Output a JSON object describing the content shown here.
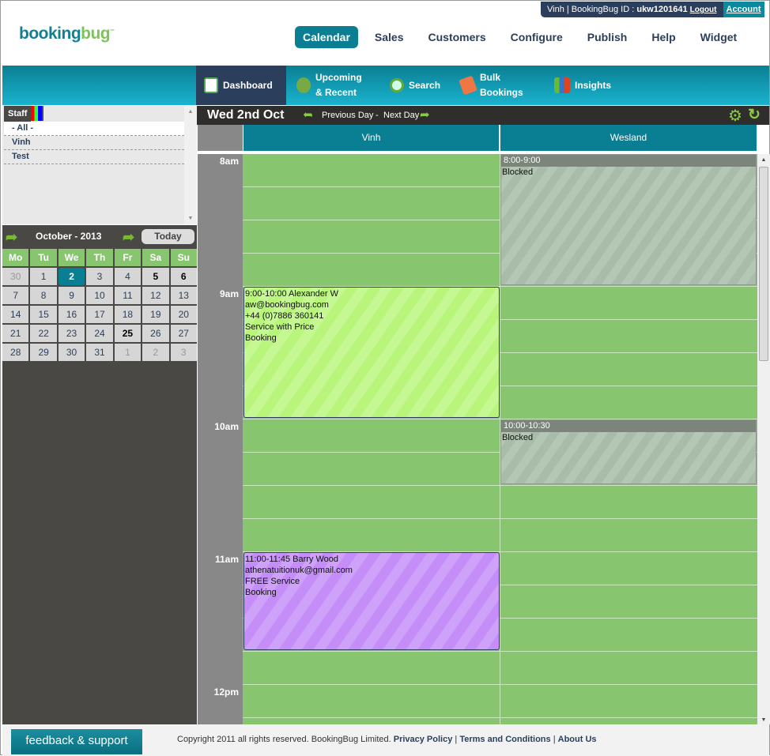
{
  "topbar": {
    "user": "Vinh | BookingBug ID : ",
    "id": "ukw1201641",
    "logout": "Logout",
    "account": "Account"
  },
  "logo": {
    "part1": "booking",
    "part2": "bug",
    "tm": "™"
  },
  "main_nav": [
    "Calendar",
    "Sales",
    "Customers",
    "Configure",
    "Publish",
    "Help",
    "Widget"
  ],
  "sub_nav": [
    {
      "label": "Dashboard",
      "icon": "calendar-icon"
    },
    {
      "label": "Upcoming & Recent",
      "icon": "alarm-clock-icon"
    },
    {
      "label": "Search",
      "icon": "magnifier-icon"
    },
    {
      "label": "Bulk Bookings",
      "icon": "bulk-icon"
    },
    {
      "label": "Insights",
      "icon": "bar-chart-icon"
    }
  ],
  "staff": {
    "tab": "Staff",
    "items": [
      "- All -",
      "Vinh",
      "Test"
    ]
  },
  "minical": {
    "title": "October - 2013",
    "today": "Today",
    "weekdays": [
      "Mo",
      "Tu",
      "We",
      "Th",
      "Fr",
      "Sa",
      "Su"
    ],
    "days": [
      "30",
      "1",
      "2",
      "3",
      "4",
      "5",
      "6",
      "7",
      "8",
      "9",
      "10",
      "11",
      "12",
      "13",
      "14",
      "15",
      "16",
      "17",
      "18",
      "19",
      "20",
      "21",
      "22",
      "23",
      "24",
      "25",
      "26",
      "27",
      "28",
      "29",
      "30",
      "31",
      "1",
      "2",
      "3"
    ],
    "selected": "2"
  },
  "day": {
    "title": "Wed 2nd Oct",
    "prev": "Previous Day",
    "sep": "-",
    "next": "Next Day"
  },
  "columns": [
    "Vinh",
    "Wesland"
  ],
  "hours": [
    "8am",
    "9am",
    "10am",
    "11am",
    "12pm"
  ],
  "events": [
    {
      "col": 1,
      "start": 8,
      "end": 9,
      "type": "blocked",
      "time": "8:00-9:00",
      "lines": [
        "Blocked"
      ]
    },
    {
      "col": 0,
      "start": 9,
      "end": 10,
      "type": "booking",
      "color": "#b8f57a",
      "time": "9:00-10:00 Alexander W",
      "lines": [
        "aw@bookingbug.com",
        "+44 (0)7886 360141",
        "Service with Price",
        "Booking"
      ]
    },
    {
      "col": 1,
      "start": 10,
      "end": 10.5,
      "type": "blocked",
      "time": "10:00-10:30",
      "lines": [
        "Blocked"
      ]
    },
    {
      "col": 0,
      "start": 11,
      "end": 11.75,
      "type": "booking",
      "color": "#c58df8",
      "time": "11:00-11:45 Barry Wood",
      "lines": [
        "athenatuitionuk@gmail.com",
        "FREE Service",
        "Booking"
      ]
    }
  ],
  "footer": {
    "feedback": "feedback & support",
    "copyright": "Copyright 2011 all rights reserved. BookingBug Limited.",
    "privacy": "Privacy Policy",
    "terms": "Terms and Conditions",
    "about": "About Us",
    "sep": "|"
  }
}
